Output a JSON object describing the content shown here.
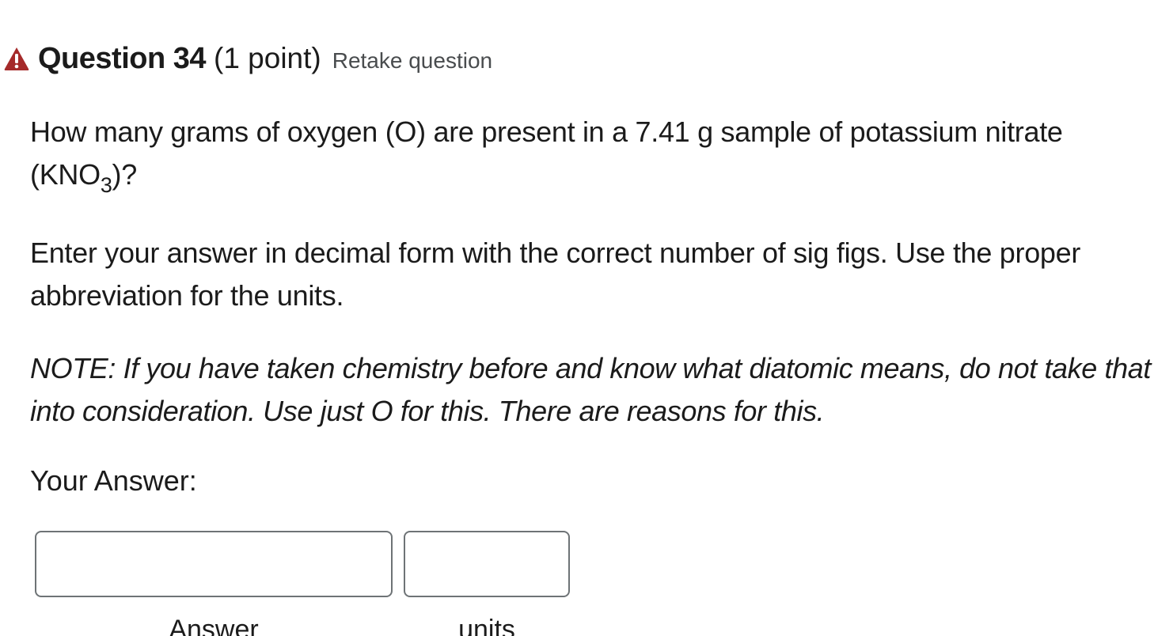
{
  "question": {
    "title": "Question 34",
    "points": "(1 point)",
    "retake_link": "Retake question",
    "status_icon": "warning-triangle-icon",
    "status_color": "#a52a2a"
  },
  "body": {
    "q1_text": "How many grams of oxygen (O) are present in a 7.41 g sample of potassium nitrate (KNO",
    "q1_subscript": "3",
    "q1_suffix": ")?",
    "instructions": "Enter your answer in decimal form with the correct number of sig figs. Use the proper abbreviation for the units.",
    "note": "NOTE:  If you have taken chemistry before and know what diatomic means, do not take that into consideration.  Use just O for this.  There are reasons for this.",
    "your_answer_label": "Your Answer:"
  },
  "answer_form": {
    "answer_value": "",
    "answer_placeholder": "",
    "answer_label": "Answer",
    "units_value": "",
    "units_placeholder": "",
    "units_label": "units"
  }
}
